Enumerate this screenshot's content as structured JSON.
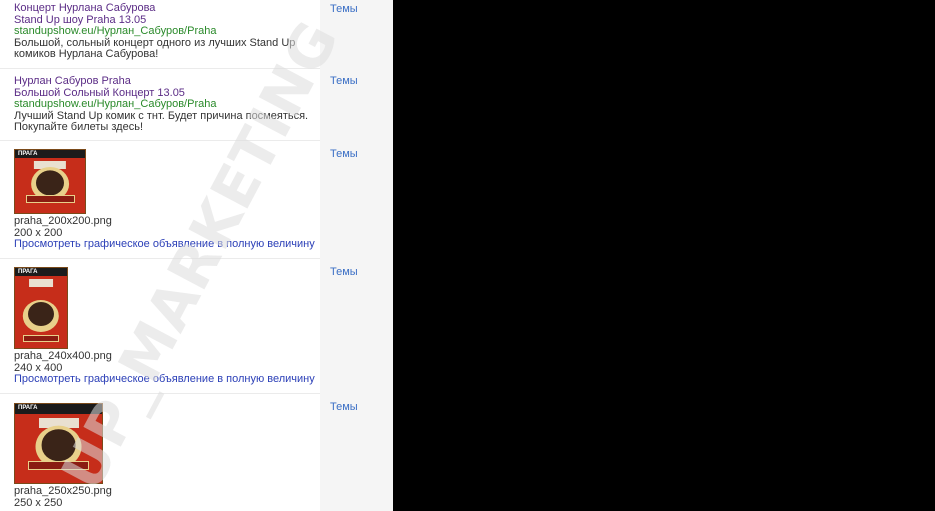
{
  "ads": [
    {
      "title": "Концерт Нурлана Сабурова",
      "subtitle": "Stand Up шоу Praha 13.05",
      "url": "standupshow.eu/Нурлан_Сабуров/Praha",
      "desc": "Большой, сольный концерт одного из лучших Stand Up комиков Нурлана Сабурова!",
      "topic": "Темы"
    },
    {
      "title": "Нурлан Сабуров Praha",
      "subtitle": "Большой Сольный Концерт 13.05",
      "url": "standupshow.eu/Нурлан_Сабуров/Praha",
      "desc": "Лучший Stand Up комик с тнт. Будет причина посмеяться. Покупайте билеты здесь!",
      "topic": "Темы"
    }
  ],
  "image_ads": [
    {
      "filename": "praha_200x200.png",
      "dimensions": "200 x 200",
      "preview_link": "Просмотреть графическое объявление в полную величину",
      "topic": "Темы",
      "thumb_label": "ПРАГА"
    },
    {
      "filename": "praha_240x400.png",
      "dimensions": "240 x 400",
      "preview_link": "Просмотреть графическое объявление в полную величину",
      "topic": "Темы",
      "thumb_label": "ПРАГА"
    },
    {
      "filename": "praha_250x250.png",
      "dimensions": "250 x 250",
      "topic": "Темы",
      "thumb_label": "ПРАГА"
    }
  ],
  "watermark": "UP_MARKETING",
  "colors": {
    "ad_title": "#5b2c86",
    "ad_url": "#2a8a2a",
    "link": "#2b3fb7",
    "topic": "#3b6fc5"
  }
}
